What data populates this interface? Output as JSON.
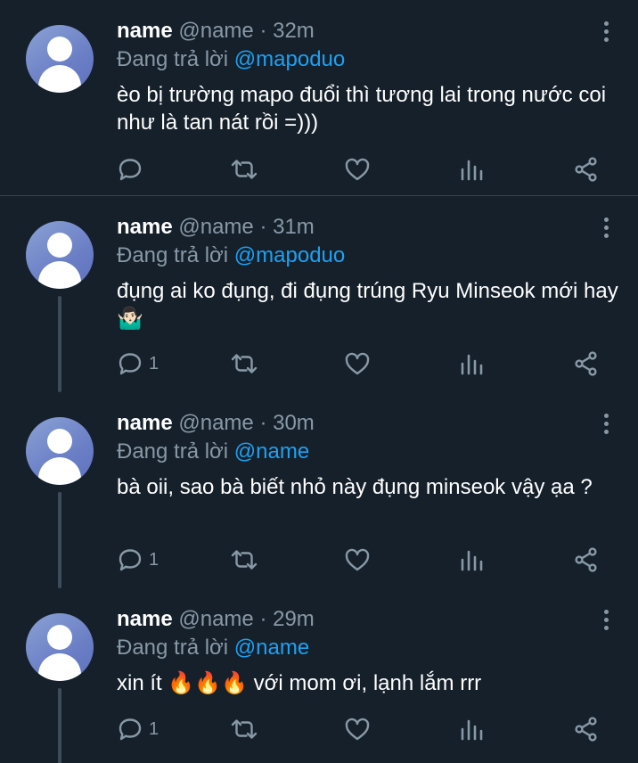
{
  "tweets": [
    {
      "name": "name",
      "handle": "@name",
      "time": "· 32m",
      "reply_prefix": "Đang trả lời",
      "reply_to": "@mapoduo",
      "text": "èo bị trường mapo đuổi thì tương lai trong nước coi như là tan nát rồi =)))",
      "reply_count": ""
    },
    {
      "name": "name",
      "handle": "@name",
      "time": "· 31m",
      "reply_prefix": "Đang trả lời",
      "reply_to": "@mapoduo",
      "text": "đụng ai ko đụng, đi đụng trúng Ryu Minseok mới hay 🤷🏻‍♂️",
      "reply_count": "1"
    },
    {
      "name": "name",
      "handle": "@name",
      "time": "· 30m",
      "reply_prefix": "Đang trả lời",
      "reply_to": "@name",
      "text": "bà oii, sao bà biết nhỏ này đụng minseok vậy ạa ?",
      "reply_count": "1"
    },
    {
      "name": "name",
      "handle": "@name",
      "time": "· 29m",
      "reply_prefix": "Đang trả lời",
      "reply_to": "@name",
      "text": "xin ít 🔥🔥🔥 với mom ơi, lạnh lắm rrr",
      "reply_count": "1"
    }
  ],
  "colors": {
    "background": "#15202b",
    "primary_text": "#ffffff",
    "secondary_text": "#8899a6",
    "mention": "#1da1f2",
    "divider": "#38444d"
  },
  "icons": {
    "reply": "reply-icon",
    "retweet": "retweet-icon",
    "like": "heart-icon",
    "analytics": "analytics-icon",
    "share": "share-icon",
    "more": "more-vertical-icon"
  }
}
